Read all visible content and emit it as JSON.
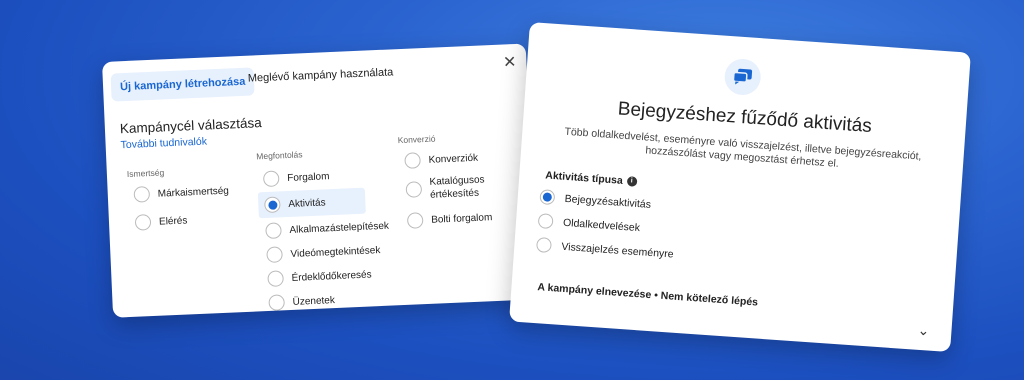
{
  "left_card": {
    "tab_new": "Új kampány létrehozása",
    "tab_existing": "Meglévő kampány használata",
    "close_icon": "close-icon",
    "section_title": "Kampánycél választása",
    "more_link": "További tudnivalók",
    "columns": {
      "awareness": {
        "heading": "Ismertség",
        "options": [
          "Márkaismertség",
          "Elérés"
        ]
      },
      "consideration": {
        "heading": "Megfontolás",
        "options": [
          "Forgalom",
          "Aktivitás",
          "Alkalmazástelepítések",
          "Videómegtekintések",
          "Érdeklődőkeresés",
          "Üzenetek"
        ],
        "selected": "Aktivitás"
      },
      "conversion": {
        "heading": "Konverzió",
        "options": [
          "Konverziók",
          "Katalógusos\nértékesítés",
          "Bolti forgalom"
        ]
      }
    }
  },
  "right_card": {
    "icon": "chat-bubbles-icon",
    "title": "Bejegyzéshez fűződő aktivitás",
    "description": "Több oldalkedvelést, eseményre való visszajelzést, illetve bejegyzésreakciót, hozzászólást vagy megosztást érhetsz el.",
    "type_label": "Aktivitás típusa",
    "info_icon": "info-icon",
    "options": [
      "Bejegyzésaktivitás",
      "Oldalkedvelések",
      "Visszajelzés eseményre"
    ],
    "selected": "Bejegyzésaktivitás",
    "campaign_name_label": "A kampány elnevezése • Nem kötelező lépés",
    "chevron_icon": "chevron-down-icon"
  },
  "colors": {
    "accent": "#1a67d2",
    "highlight": "#e7f0fd",
    "background": "#2a63cf"
  }
}
